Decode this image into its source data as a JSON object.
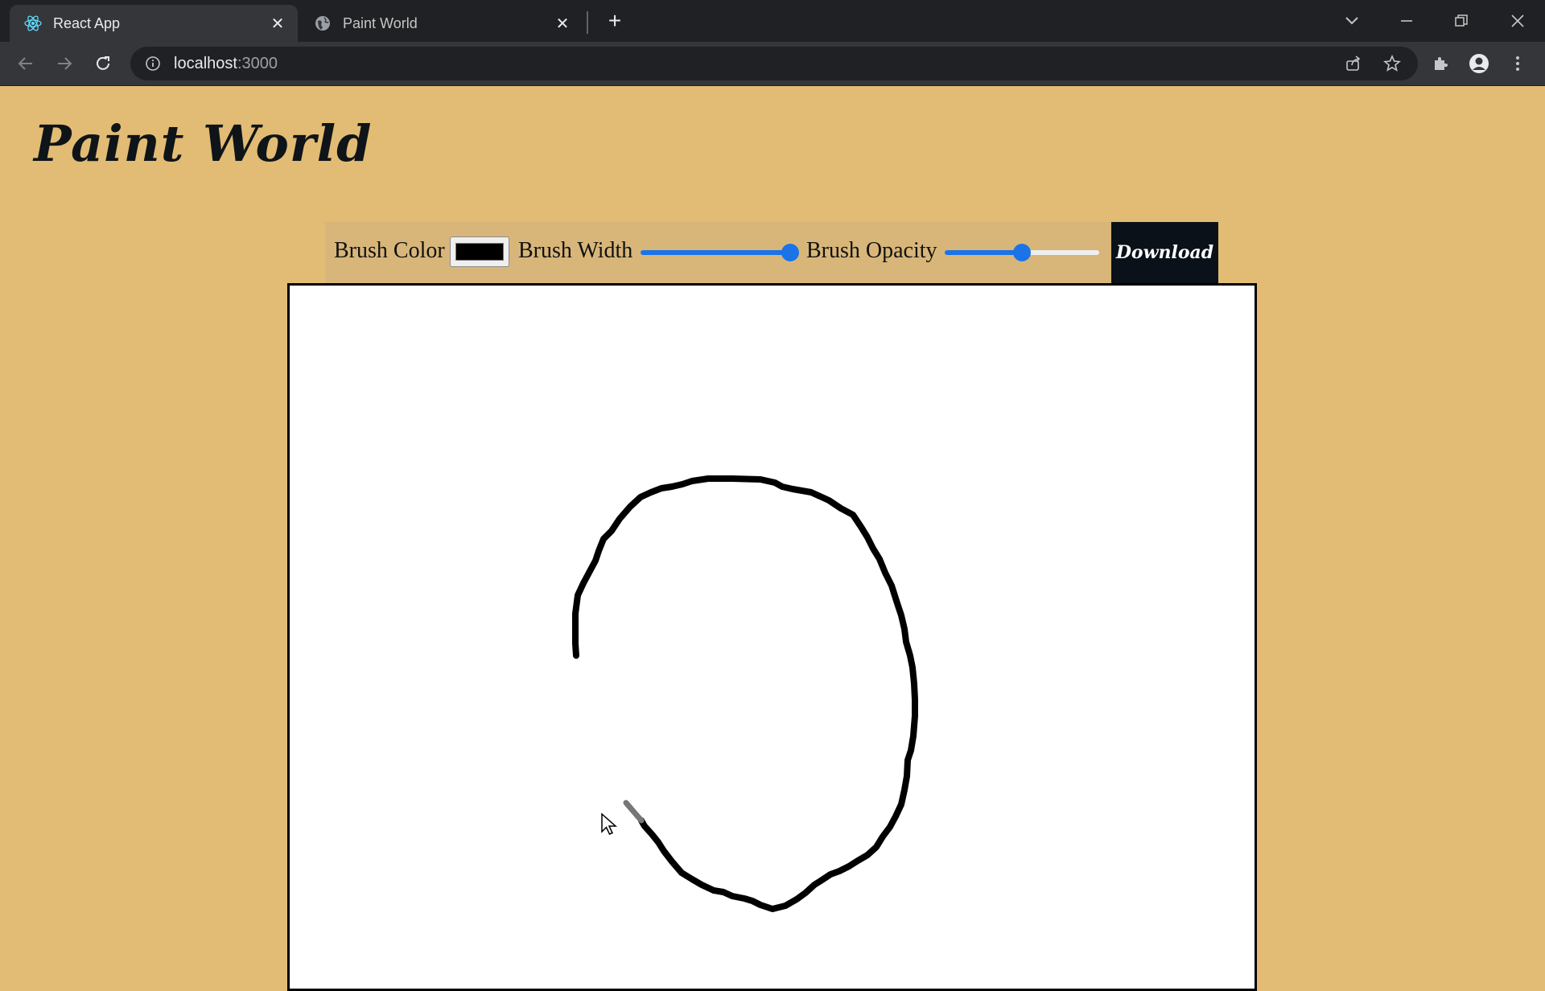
{
  "browser": {
    "tabs": [
      {
        "title": "React App",
        "active": true,
        "icon": "react-icon"
      },
      {
        "title": "Paint World",
        "active": false,
        "icon": "globe-icon"
      }
    ],
    "address": {
      "host": "localhost",
      "port": ":3000"
    }
  },
  "page": {
    "title": "Paint World",
    "controls": {
      "brush_color_label": "Brush Color",
      "brush_color": "#000000",
      "brush_width_label": "Brush Width",
      "brush_width_value": 0.95,
      "brush_opacity_label": "Brush Opacity",
      "brush_opacity_value": 0.5,
      "download_label": "Download"
    }
  },
  "colors": {
    "page_background": "#e2bc74",
    "accent": "#1a73e8",
    "download_background": "#0a1118"
  }
}
